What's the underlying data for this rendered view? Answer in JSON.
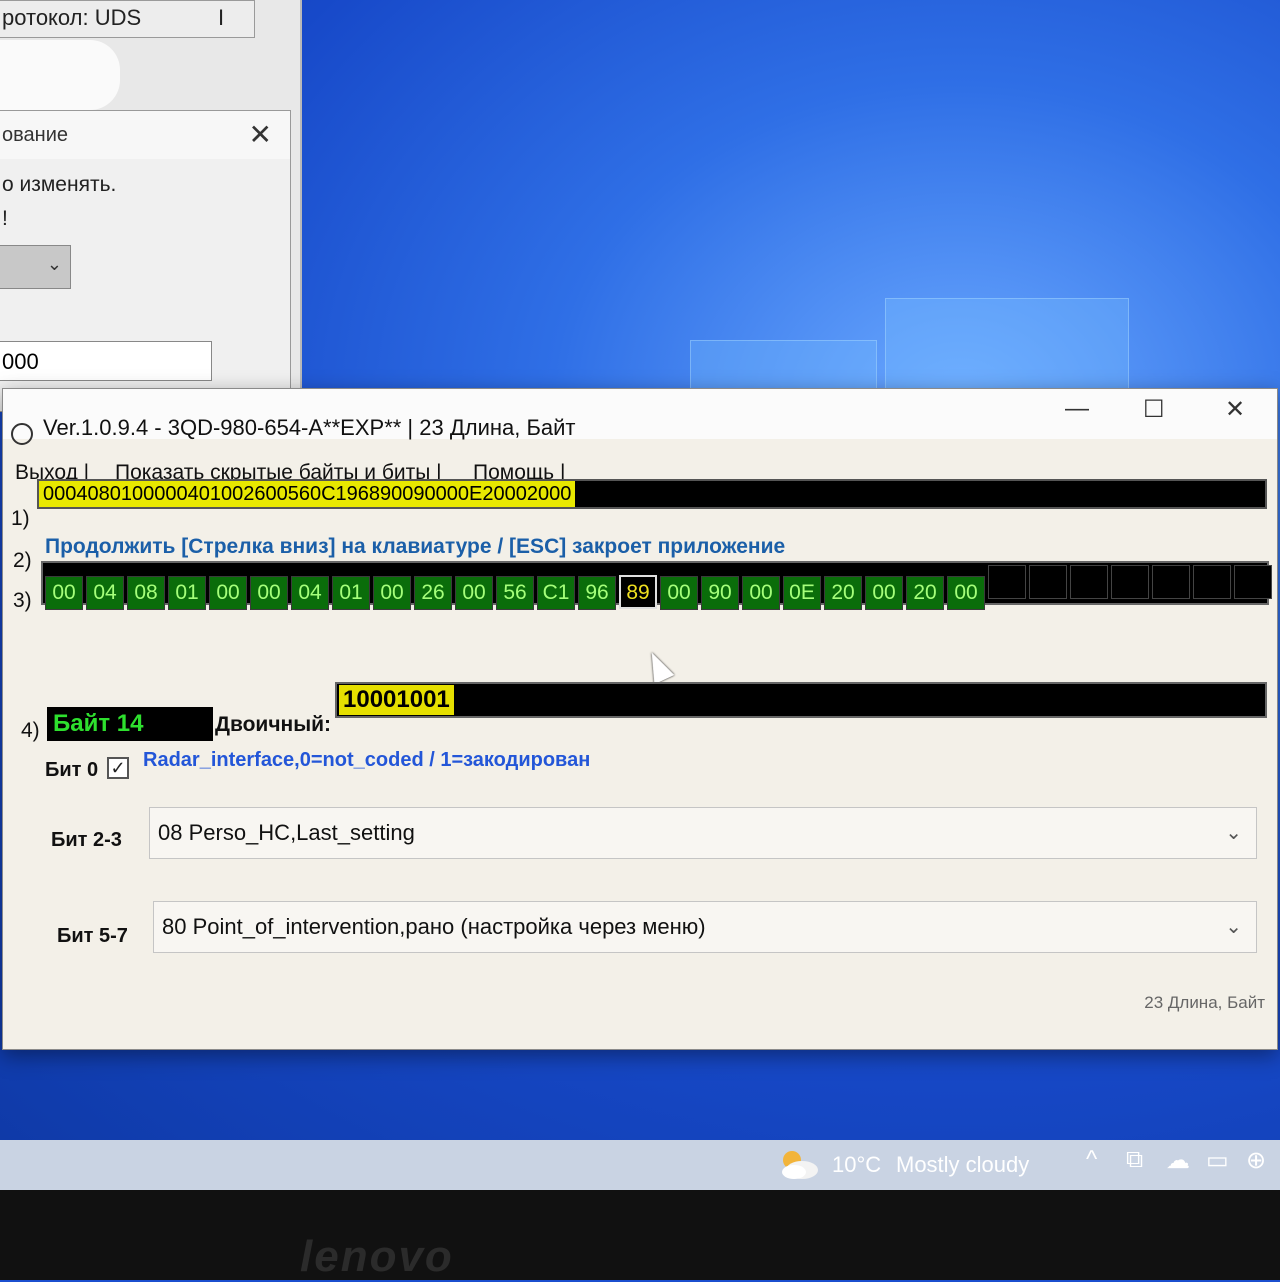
{
  "background_window": {
    "protocol_text": "ротокол: UDS",
    "protocol_marker": "I",
    "dialog_title": "ование",
    "dialog_close": "✕",
    "message_line1": "о изменять.",
    "message_line2": "!",
    "combo_chevron": "⌄",
    "field_value": "000"
  },
  "app": {
    "title": "Ver.1.0.9.4 -   3QD-980-654-A**EXP** | 23 Длина, Байт",
    "title_buttons": {
      "minimize": "—",
      "maximize": "☐",
      "close": "✕"
    },
    "menu": {
      "exit": "Выход |",
      "show_hidden": "Показать скрытые байты и биты |",
      "help": "Помощь |"
    },
    "row_labels": {
      "r1": "1)",
      "r2": "2)",
      "r3": "3)",
      "r4": "4)"
    },
    "hex_string": "0004080100000401002600560C196890090000E20002000",
    "hint": "Продолжить [Стрелка вниз] на клавиатуре / [ESC] закроет приложение",
    "bytes": [
      "00",
      "04",
      "08",
      "01",
      "00",
      "00",
      "04",
      "01",
      "00",
      "26",
      "00",
      "56",
      "C1",
      "96",
      "89",
      "00",
      "90",
      "00",
      "0E",
      "20",
      "00",
      "20",
      "00"
    ],
    "selected_byte_index": 14,
    "empty_cells_after": 7,
    "byte_label": "Байт 14",
    "binary_label": "Двоичный:",
    "binary_value": "10001001",
    "bit0": {
      "label": "Бит 0",
      "checked": true,
      "check_glyph": "✓",
      "description": "Radar_interface,0=not_coded / 1=закодирован"
    },
    "bit23": {
      "label": "Бит 2-3",
      "value": "08 Perso_HC,Last_setting"
    },
    "bit57": {
      "label": "Бит 5-7",
      "value": "80 Point_of_intervention,рано (настройка через меню)"
    },
    "combo_chevron": "⌄",
    "status": "23 Длина, Байт"
  },
  "taskbar": {
    "temperature": "10°C",
    "weather": "Mostly cloudy",
    "tray": {
      "up": "^",
      "meet": "⧉",
      "network": "☁",
      "battery": "▭",
      "language": "⊕"
    }
  },
  "bezel": {
    "brand": "lenovo"
  },
  "colors": {
    "desktop_blue": "#1749c9",
    "hex_highlight": "#e8e800",
    "byte_green": "#0a6d0a",
    "hint_blue": "#1b5fa8",
    "bit_desc_blue": "#2356d8"
  }
}
